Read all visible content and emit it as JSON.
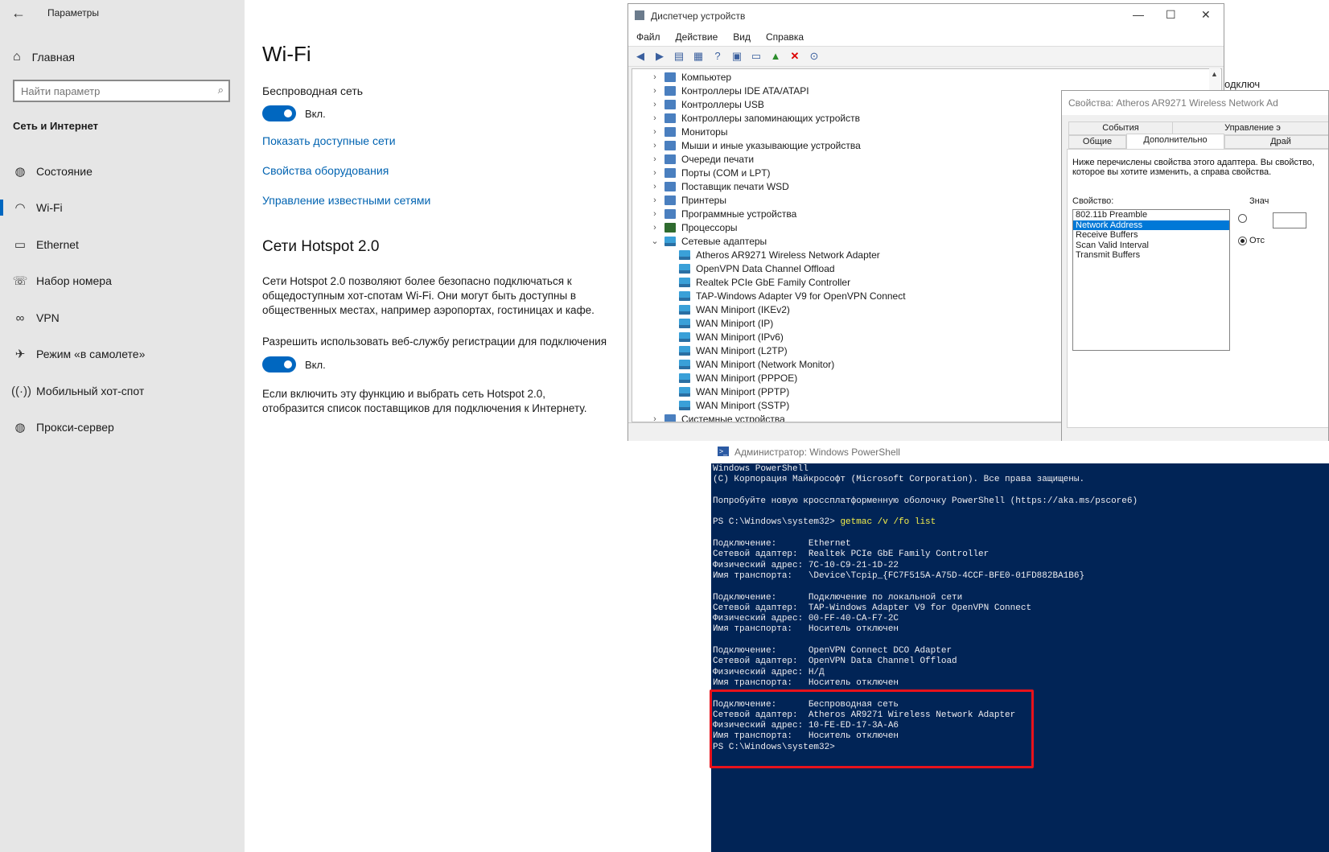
{
  "settings": {
    "app_title": "Параметры",
    "home_label": "Главная",
    "search_placeholder": "Найти параметр",
    "section_title": "Сеть и Интернет",
    "nav": [
      {
        "label": "Состояние",
        "icon": "globe-icon"
      },
      {
        "label": "Wi-Fi",
        "icon": "wifi-icon"
      },
      {
        "label": "Ethernet",
        "icon": "ethernet-icon"
      },
      {
        "label": "Набор номера",
        "icon": "dialup-icon"
      },
      {
        "label": "VPN",
        "icon": "vpn-icon"
      },
      {
        "label": "Режим «в самолете»",
        "icon": "airplane-icon"
      },
      {
        "label": "Мобильный хот-спот",
        "icon": "hotspot-icon"
      },
      {
        "label": "Прокси-сервер",
        "icon": "globe-icon"
      }
    ],
    "active_nav": "Wi-Fi",
    "page_title": "Wi-Fi",
    "wireless_label": "Беспроводная сеть",
    "wireless_toggle": "Вкл.",
    "links": [
      "Показать доступные сети",
      "Свойства оборудования",
      "Управление известными сетями"
    ],
    "hotspot_title": "Сети Hotspot 2.0",
    "hotspot_desc": "Сети Hotspot 2.0 позволяют более безопасно подключаться к общедоступным хот-спотам Wi-Fi. Они могут быть доступны в общественных местах, например аэропортах, гостиницах и кафе.",
    "allow_label": "Разрешить использовать веб-службу регистрации для подключения",
    "allow_toggle": "Вкл.",
    "allow_desc": "Если включить эту функцию и выбрать сеть Hotspot 2.0, отобразится список поставщиков для подключения к Интернету."
  },
  "device_manager": {
    "title": "Диспетчер устройств",
    "menu": [
      "Файл",
      "Действие",
      "Вид",
      "Справка"
    ],
    "categories": [
      "Компьютер",
      "Контроллеры IDE ATA/ATAPI",
      "Контроллеры USB",
      "Контроллеры запоминающих устройств",
      "Мониторы",
      "Мыши и иные указывающие устройства",
      "Очереди печати",
      "Порты (COM и LPT)",
      "Поставщик печати WSD",
      "Принтеры",
      "Программные устройства",
      "Процессоры",
      "Сетевые адаптеры"
    ],
    "network_adapters": [
      "Atheros AR9271 Wireless Network Adapter",
      "OpenVPN Data Channel Offload",
      "Realtek PCIe GbE Family Controller",
      "TAP-Windows Adapter V9 for OpenVPN Connect",
      "WAN Miniport (IKEv2)",
      "WAN Miniport (IP)",
      "WAN Miniport (IPv6)",
      "WAN Miniport (L2TP)",
      "WAN Miniport (Network Monitor)",
      "WAN Miniport (PPPOE)",
      "WAN Miniport (PPTP)",
      "WAN Miniport (SSTP)"
    ],
    "last_category": "Системные устройства",
    "side_text": "одключ"
  },
  "properties": {
    "title": "Свойства: Atheros AR9271 Wireless Network Ad",
    "tabs_row1": [
      "События",
      "Управление э"
    ],
    "tabs_row2": [
      "Общие",
      "Дополнительно",
      "Драй"
    ],
    "selected_tab": "Дополнительно",
    "desc": "Ниже перечислены свойства этого адаптера. Вы свойство, которое вы хотите изменить, а справа свойства.",
    "property_label": "Свойство:",
    "value_label": "Знач",
    "properties_list": [
      "802.11b Preamble",
      "Network Address",
      "Receive Buffers",
      "Scan Valid Interval",
      "Transmit Buffers"
    ],
    "selected_property": "Network Address",
    "radio_off_label": "Отс"
  },
  "powershell": {
    "title": "Администратор: Windows PowerShell",
    "lines": [
      "Windows PowerShell",
      "(C) Корпорация Майкрософт (Microsoft Corporation). Все права защищены.",
      "",
      "Попробуйте новую кроссплатформенную оболочку PowerShell (https://aka.ms/pscore6)",
      "",
      "PS C:\\Windows\\system32> ",
      "",
      "Подключение:      Ethernet",
      "Сетевой адаптер:  Realtek PCIe GbE Family Controller",
      "Физический адрес: 7C-10-C9-21-1D-22",
      "Имя транспорта:   \\Device\\Tcpip_{FC7F515A-A75D-4CCF-BFE0-01FD882BA1B6}",
      "",
      "Подключение:      Подключение по локальной сети",
      "Сетевой адаптер:  TAP-Windows Adapter V9 for OpenVPN Connect",
      "Физический адрес: 00-FF-40-CA-F7-2C",
      "Имя транспорта:   Носитель отключен",
      "",
      "Подключение:      OpenVPN Connect DCO Adapter",
      "Сетевой адаптер:  OpenVPN Data Channel Offload",
      "Физический адрес: Н/Д",
      "Имя транспорта:   Носитель отключен",
      "",
      "Подключение:      Беспроводная сеть",
      "Сетевой адаптер:  Atheros AR9271 Wireless Network Adapter",
      "Физический адрес: 10-FE-ED-17-3A-A6",
      "Имя транспорта:   Носитель отключен",
      "PS C:\\Windows\\system32>"
    ],
    "command": "getmac /v /fo list",
    "command_line_index": 5
  },
  "colors": {
    "accent": "#0067c0",
    "link": "#0063b1",
    "powershell_bg": "#012456",
    "command": "#f6f04a",
    "highlight": "#e8121b"
  }
}
